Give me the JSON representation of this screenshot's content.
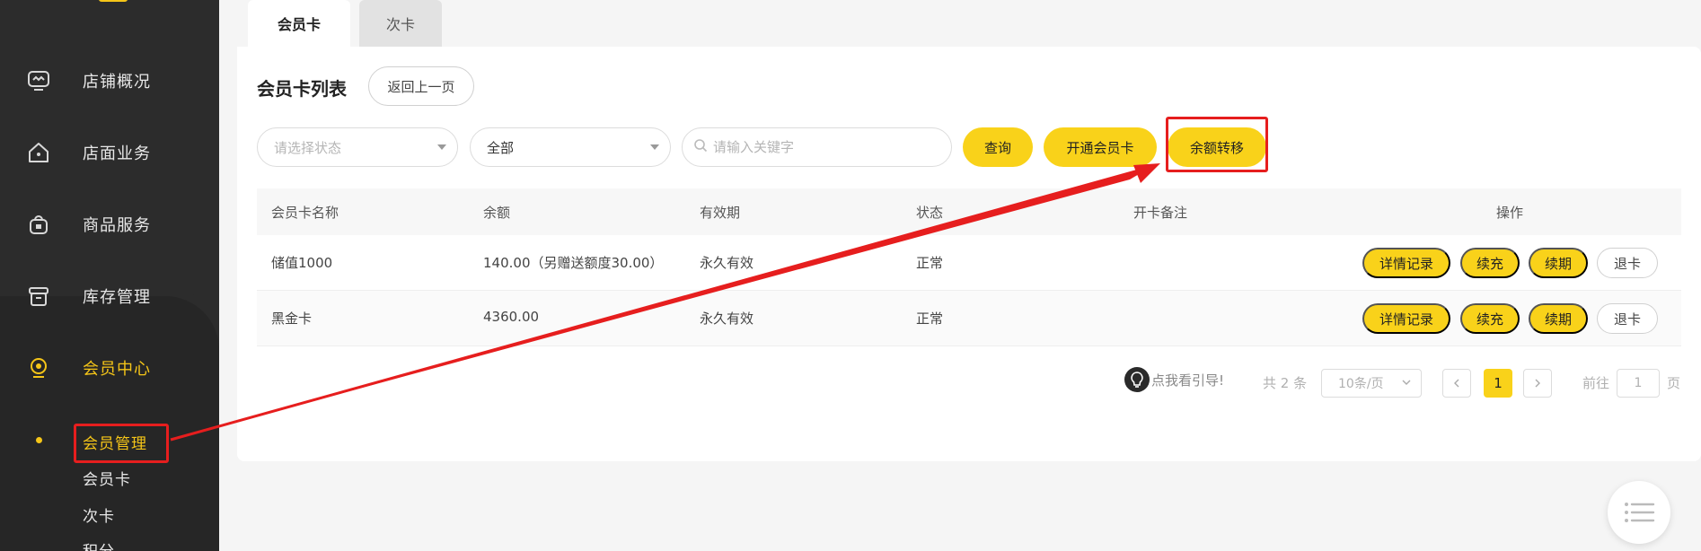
{
  "sidebar": {
    "items": [
      {
        "label": "店铺概况",
        "icon": "monitor-icon"
      },
      {
        "label": "店面业务",
        "icon": "home-icon"
      },
      {
        "label": "商品服务",
        "icon": "bag-icon"
      },
      {
        "label": "库存管理",
        "icon": "box-icon"
      },
      {
        "label": "会员中心",
        "icon": "member-icon"
      }
    ],
    "subitems": [
      {
        "label": "会员管理"
      },
      {
        "label": "会员卡"
      },
      {
        "label": "次卡"
      },
      {
        "label": "积分"
      }
    ],
    "active_color": "#f5c518"
  },
  "tabs": [
    {
      "label": "会员卡"
    },
    {
      "label": "次卡"
    }
  ],
  "header": {
    "title": "会员卡列表",
    "back_label": "返回上一页"
  },
  "filters": {
    "status_placeholder": "请选择状态",
    "type_value": "全部",
    "search_placeholder": "请输入关键字"
  },
  "actions": {
    "query": "查询",
    "open_card": "开通会员卡",
    "transfer": "余额转移"
  },
  "table": {
    "headers": [
      "会员卡名称",
      "余额",
      "有效期",
      "状态",
      "开卡备注",
      "操作"
    ],
    "rows": [
      {
        "name": "储值1000",
        "balance": "140.00（另赠送额度30.00）",
        "validity": "永久有效",
        "status": "正常",
        "note": ""
      },
      {
        "name": "黑金卡",
        "balance": "4360.00",
        "validity": "永久有效",
        "status": "正常",
        "note": ""
      }
    ],
    "row_actions": [
      "详情记录",
      "续充",
      "续期",
      "退卡"
    ]
  },
  "pagination": {
    "guide": "点我看引导!",
    "total": "共 2 条",
    "page_size": "10条/页",
    "current": "1",
    "goto_prefix": "前往",
    "goto_value": "1",
    "goto_suffix": "页"
  },
  "colors": {
    "accent": "#f9d21a",
    "sidebar_bg": "#2c2c2c",
    "annotation_red": "#e61e1e"
  }
}
